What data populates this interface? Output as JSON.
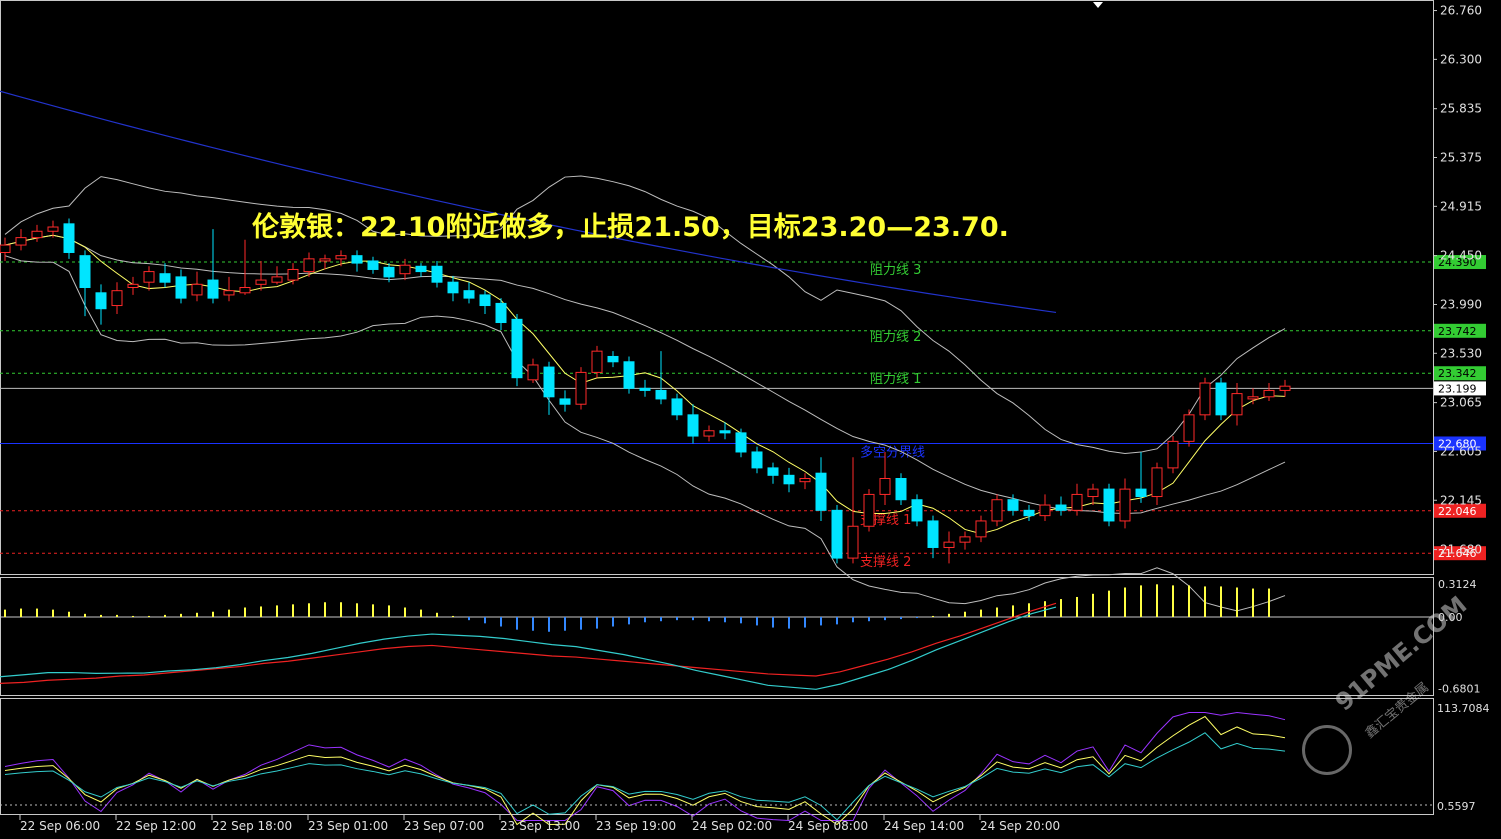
{
  "headline": "伦敦银：22.10附近做多，止损21.50，目标23.20—23.70.",
  "chart_data": {
    "type": "candlestick",
    "price_scale_labels": [
      "26.760",
      "26.300",
      "25.835",
      "25.375",
      "24.915",
      "24.450",
      "23.990",
      "23.530",
      "23.065",
      "22.605",
      "22.145",
      "21.680"
    ],
    "current_price": "23.199",
    "ylim": [
      21.45,
      26.85
    ],
    "x_tick_labels": [
      "22 Sep 06:00",
      "22 Sep 12:00",
      "22 Sep 18:00",
      "23 Sep 01:00",
      "23 Sep 07:00",
      "23 Sep 13:00",
      "23 Sep 19:00",
      "24 Sep 02:00",
      "24 Sep 08:00",
      "24 Sep 14:00",
      "24 Sep 20:00"
    ],
    "levels": [
      {
        "name": "阻力线 3",
        "value": 24.39,
        "label": "24.390",
        "color": "#33cc33"
      },
      {
        "name": "阻力线 2",
        "value": 23.742,
        "label": "23.742",
        "color": "#33cc33"
      },
      {
        "name": "阻力线 1",
        "value": 23.342,
        "label": "23.342",
        "color": "#33cc33"
      },
      {
        "name": "多空分界线",
        "value": 22.68,
        "label": "22.680",
        "color": "#1a33ff"
      },
      {
        "name": "支撑线 1",
        "value": 22.046,
        "label": "22.046",
        "color": "#ee2222"
      },
      {
        "name": "支撑线 2",
        "value": 21.646,
        "label": "21.646",
        "color": "#ee2222"
      }
    ],
    "candles": [
      [
        24.48,
        24.55,
        24.62,
        24.4
      ],
      [
        24.55,
        24.62,
        24.7,
        24.5
      ],
      [
        24.62,
        24.68,
        24.74,
        24.58
      ],
      [
        24.68,
        24.72,
        24.78,
        24.62
      ],
      [
        24.75,
        24.48,
        24.8,
        24.42
      ],
      [
        24.45,
        24.15,
        24.5,
        23.88
      ],
      [
        24.1,
        23.95,
        24.18,
        23.8
      ],
      [
        23.98,
        24.12,
        24.2,
        23.9
      ],
      [
        24.15,
        24.18,
        24.25,
        24.08
      ],
      [
        24.2,
        24.3,
        24.35,
        24.12
      ],
      [
        24.28,
        24.2,
        24.38,
        24.15
      ],
      [
        24.25,
        24.05,
        24.32,
        24.0
      ],
      [
        24.08,
        24.18,
        24.3,
        24.02
      ],
      [
        24.22,
        24.05,
        24.7,
        24.0
      ],
      [
        24.08,
        24.12,
        24.25,
        24.02
      ],
      [
        24.1,
        24.15,
        24.6,
        24.08
      ],
      [
        24.18,
        24.22,
        24.4,
        24.12
      ],
      [
        24.2,
        24.25,
        24.35,
        24.18
      ],
      [
        24.22,
        24.32,
        24.38,
        24.18
      ],
      [
        24.3,
        24.42,
        24.48,
        24.25
      ],
      [
        24.4,
        24.42,
        24.46,
        24.32
      ],
      [
        24.42,
        24.45,
        24.5,
        24.35
      ],
      [
        24.45,
        24.38,
        24.5,
        24.3
      ],
      [
        24.4,
        24.32,
        24.44,
        24.28
      ],
      [
        24.34,
        24.25,
        24.38,
        24.2
      ],
      [
        24.28,
        24.36,
        24.42,
        24.22
      ],
      [
        24.35,
        24.3,
        24.38,
        24.25
      ],
      [
        24.35,
        24.2,
        24.4,
        24.15
      ],
      [
        24.2,
        24.1,
        24.26,
        24.02
      ],
      [
        24.12,
        24.05,
        24.2,
        24.0
      ],
      [
        24.08,
        23.98,
        24.12,
        23.9
      ],
      [
        24.0,
        23.82,
        24.05,
        23.75
      ],
      [
        23.85,
        23.3,
        23.9,
        23.22
      ],
      [
        23.28,
        23.42,
        23.48,
        23.25
      ],
      [
        23.4,
        23.12,
        23.45,
        22.95
      ],
      [
        23.1,
        23.05,
        23.18,
        22.98
      ],
      [
        23.05,
        23.35,
        23.4,
        23.0
      ],
      [
        23.35,
        23.55,
        23.6,
        23.3
      ],
      [
        23.5,
        23.45,
        23.55,
        23.4
      ],
      [
        23.45,
        23.2,
        23.5,
        23.15
      ],
      [
        23.2,
        23.18,
        23.28,
        23.12
      ],
      [
        23.18,
        23.1,
        23.55,
        23.05
      ],
      [
        23.1,
        22.95,
        23.15,
        22.9
      ],
      [
        22.95,
        22.75,
        23.05,
        22.68
      ],
      [
        22.75,
        22.8,
        22.85,
        22.7
      ],
      [
        22.8,
        22.78,
        22.88,
        22.72
      ],
      [
        22.78,
        22.6,
        22.82,
        22.55
      ],
      [
        22.6,
        22.45,
        22.65,
        22.4
      ],
      [
        22.45,
        22.38,
        22.5,
        22.3
      ],
      [
        22.38,
        22.3,
        22.45,
        22.22
      ],
      [
        22.32,
        22.35,
        22.4,
        22.25
      ],
      [
        22.4,
        22.05,
        22.55,
        21.95
      ],
      [
        22.05,
        21.6,
        22.1,
        21.55
      ],
      [
        21.6,
        21.9,
        22.55,
        21.55
      ],
      [
        21.9,
        22.2,
        22.25,
        21.85
      ],
      [
        22.2,
        22.35,
        22.6,
        22.1
      ],
      [
        22.35,
        22.15,
        22.4,
        22.1
      ],
      [
        22.15,
        21.95,
        22.2,
        21.9
      ],
      [
        21.95,
        21.7,
        22.0,
        21.6
      ],
      [
        21.7,
        21.75,
        21.85,
        21.55
      ],
      [
        21.75,
        21.8,
        21.85,
        21.68
      ],
      [
        21.8,
        21.95,
        22.0,
        21.75
      ],
      [
        21.95,
        22.15,
        22.2,
        21.9
      ],
      [
        22.15,
        22.05,
        22.2,
        22.0
      ],
      [
        22.05,
        22.0,
        22.1,
        21.95
      ],
      [
        22.0,
        22.1,
        22.2,
        21.95
      ],
      [
        22.1,
        22.05,
        22.18,
        22.0
      ],
      [
        22.05,
        22.2,
        22.3,
        22.0
      ],
      [
        22.18,
        22.25,
        22.3,
        22.1
      ],
      [
        22.25,
        21.95,
        22.3,
        21.9
      ],
      [
        21.95,
        22.25,
        22.35,
        21.88
      ],
      [
        22.25,
        22.18,
        22.6,
        22.12
      ],
      [
        22.18,
        22.45,
        22.5,
        22.1
      ],
      [
        22.45,
        22.7,
        22.75,
        22.4
      ],
      [
        22.7,
        22.95,
        23.0,
        22.65
      ],
      [
        22.95,
        23.25,
        23.3,
        22.9
      ],
      [
        23.25,
        22.95,
        23.3,
        22.9
      ],
      [
        22.95,
        23.15,
        23.25,
        22.85
      ],
      [
        23.1,
        23.12,
        23.2,
        23.05
      ],
      [
        23.12,
        23.18,
        23.25,
        23.08
      ],
      [
        23.18,
        23.22,
        23.28,
        23.12
      ]
    ],
    "ma_overlays": [
      "bollinger_upper",
      "bollinger_mid",
      "bollinger_lower",
      "ma_fast",
      "ma_long"
    ],
    "macd": {
      "labels": [
        "0.3124",
        "0.00",
        "-0.6801"
      ],
      "ylim": [
        -0.74,
        0.37
      ],
      "histogram": [
        0.07,
        0.08,
        0.08,
        0.07,
        0.05,
        0.03,
        0.02,
        0.02,
        0.01,
        0.01,
        0.02,
        0.03,
        0.04,
        0.05,
        0.07,
        0.09,
        0.1,
        0.11,
        0.12,
        0.13,
        0.14,
        0.14,
        0.13,
        0.12,
        0.11,
        0.09,
        0.07,
        0.04,
        0.01,
        -0.03,
        -0.06,
        -0.09,
        -0.12,
        -0.13,
        -0.14,
        -0.13,
        -0.12,
        -0.11,
        -0.09,
        -0.07,
        -0.05,
        -0.04,
        -0.03,
        -0.03,
        -0.04,
        -0.05,
        -0.06,
        -0.08,
        -0.1,
        -0.11,
        -0.1,
        -0.08,
        -0.07,
        -0.05,
        -0.04,
        -0.03,
        -0.02,
        -0.01,
        0.01,
        0.03,
        0.05,
        0.07,
        0.09,
        0.11,
        0.13,
        0.15,
        0.17,
        0.19,
        0.22,
        0.25,
        0.28,
        0.3,
        0.31,
        0.3,
        0.3,
        0.29,
        0.29,
        0.28,
        0.27,
        0.27
      ],
      "signal": [
        -0.63,
        -0.62,
        -0.6,
        -0.59,
        -0.58,
        -0.56,
        -0.55,
        -0.53,
        -0.51,
        -0.49,
        -0.47,
        -0.44,
        -0.42,
        -0.39,
        -0.36,
        -0.33,
        -0.3,
        -0.28,
        -0.27,
        -0.29,
        -0.31,
        -0.33,
        -0.35,
        -0.37,
        -0.38,
        -0.4,
        -0.42,
        -0.44,
        -0.46,
        -0.48,
        -0.5,
        -0.52,
        -0.54,
        -0.55,
        -0.56,
        -0.52,
        -0.46,
        -0.4,
        -0.33,
        -0.25,
        -0.18,
        -0.1,
        -0.02,
        0.06,
        0.13
      ]
    }
  },
  "indicator_labels": {
    "rsi_top": "113.7084",
    "rsi_bottom": "0.5597"
  },
  "watermark": {
    "brand": "91PME.COM",
    "sub": "鑫汇宝贵金属"
  }
}
